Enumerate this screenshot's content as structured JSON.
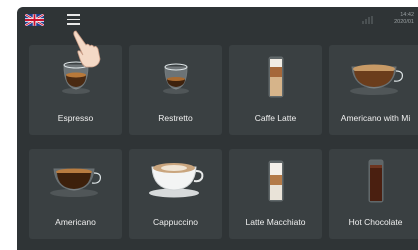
{
  "header": {
    "language_flag": "uk-flag-icon",
    "menu_icon": "hamburger-menu-icon",
    "time": "14:42",
    "date": "2020/01"
  },
  "drinks": [
    {
      "label": "Espresso",
      "icon": "espresso-cup-icon"
    },
    {
      "label": "Restretto",
      "icon": "ristretto-cup-icon"
    },
    {
      "label": "Caffe Latte",
      "icon": "latte-glass-icon"
    },
    {
      "label": "Americano with Mi",
      "icon": "americano-milk-cup-icon"
    },
    {
      "label": "Americano",
      "icon": "americano-cup-icon"
    },
    {
      "label": "Cappuccino",
      "icon": "cappuccino-cup-icon"
    },
    {
      "label": "Latte Macchiato",
      "icon": "macchiato-glass-icon"
    },
    {
      "label": "Hot Chocolate",
      "icon": "hot-chocolate-glass-icon"
    }
  ],
  "colors": {
    "screen_bg": "#2f3436",
    "tile_bg": "#3a4042",
    "text": "#f0f0f0"
  }
}
